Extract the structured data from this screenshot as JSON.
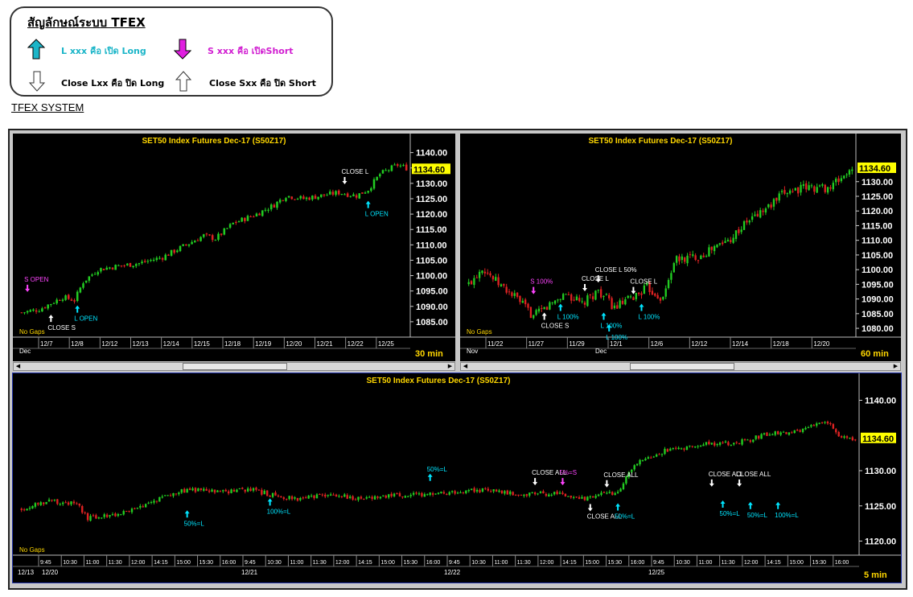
{
  "legend": {
    "title": "สัญลักษณ์ระบบ TFEX",
    "items": [
      {
        "label": "L xxx คือ เปิด Long",
        "color": "#1bb5c8",
        "icon": "arrow-up-filled-cyan"
      },
      {
        "label": "S xxx คือ เปิดShort",
        "color": "#d11fd1",
        "icon": "arrow-down-filled-magenta"
      },
      {
        "label": "Close Lxx คือ ปิด Long",
        "color": "#000000",
        "icon": "arrow-down-outline"
      },
      {
        "label": "Close Sxx คือ ปิด Short",
        "color": "#000000",
        "icon": "arrow-up-outline"
      }
    ]
  },
  "system_title": "TFEX SYSTEM",
  "colors": {
    "up": "#22cc22",
    "down": "#dd2222",
    "title": "#ffd700",
    "last_price_bg": "#ffff00",
    "long": "#00e5ff",
    "short": "#ff44ff",
    "close": "#ffffff"
  },
  "chart_data": [
    {
      "type": "candlestick",
      "title": "SET50 Index Futures Dec-17 (S50Z17)",
      "timeframe": "30 min",
      "note": "No Gaps",
      "last_price": "1134.60",
      "ylim": [
        1080,
        1142
      ],
      "y_ticks": [
        "1140.00",
        "1135.00",
        "1130.00",
        "1125.00",
        "1120.00",
        "1115.00",
        "1110.00",
        "1105.00",
        "1100.00",
        "1095.00",
        "1090.00",
        "1085.00"
      ],
      "x_labels": [
        "12/7",
        "12/8",
        "12/12",
        "12/13",
        "12/14",
        "12/15",
        "12/18",
        "12/19",
        "12/20",
        "12/21",
        "12/22",
        "12/25"
      ],
      "month_label": "Dec",
      "path": [
        [
          0,
          1088
        ],
        [
          6,
          1089
        ],
        [
          10,
          1091
        ],
        [
          14,
          1093
        ],
        [
          18,
          1092
        ],
        [
          21,
          1098
        ],
        [
          26,
          1102
        ],
        [
          32,
          1103
        ],
        [
          40,
          1104
        ],
        [
          48,
          1106
        ],
        [
          56,
          1110
        ],
        [
          62,
          1113
        ],
        [
          66,
          1112
        ],
        [
          72,
          1117
        ],
        [
          80,
          1120
        ],
        [
          86,
          1123
        ],
        [
          90,
          1126
        ],
        [
          96,
          1125
        ],
        [
          102,
          1126
        ],
        [
          108,
          1127
        ],
        [
          114,
          1126
        ],
        [
          118,
          1128
        ],
        [
          122,
          1133
        ],
        [
          128,
          1136
        ],
        [
          131,
          1135
        ]
      ],
      "signals": [
        {
          "i": 2,
          "label": "S OPEN",
          "kind": "short",
          "price": 1096,
          "pos": "above"
        },
        {
          "i": 10,
          "label": "CLOSE S",
          "kind": "close-short",
          "price": 1086,
          "pos": "below"
        },
        {
          "i": 19,
          "label": "L OPEN",
          "kind": "long",
          "price": 1089,
          "pos": "below"
        },
        {
          "i": 110,
          "label": "CLOSE L",
          "kind": "close-long",
          "price": 1131,
          "pos": "above"
        },
        {
          "i": 118,
          "label": "L OPEN",
          "kind": "long",
          "price": 1123,
          "pos": "below"
        }
      ]
    },
    {
      "type": "candlestick",
      "title": "SET50 Index Futures Dec-17 (S50Z17)",
      "timeframe": "60 min",
      "note": "No Gaps",
      "last_price": "1134.60",
      "ylim": [
        1077,
        1142
      ],
      "y_ticks": [
        "1130.00",
        "1125.00",
        "1120.00",
        "1115.00",
        "1110.00",
        "1105.00",
        "1100.00",
        "1095.00",
        "1090.00",
        "1085.00",
        "1080.00"
      ],
      "x_labels": [
        "11/22",
        "11/27",
        "11/29",
        "12/1",
        "12/6",
        "12/12",
        "12/14",
        "12/18",
        "12/20"
      ],
      "month_labels": [
        "Nov",
        "Dec"
      ],
      "path": [
        [
          0,
          1095
        ],
        [
          5,
          1101
        ],
        [
          10,
          1096
        ],
        [
          18,
          1090
        ],
        [
          24,
          1084
        ],
        [
          30,
          1088
        ],
        [
          36,
          1092
        ],
        [
          42,
          1088
        ],
        [
          48,
          1093
        ],
        [
          54,
          1087
        ],
        [
          60,
          1090
        ],
        [
          66,
          1094
        ],
        [
          72,
          1090
        ],
        [
          76,
          1103
        ],
        [
          86,
          1105
        ],
        [
          96,
          1110
        ],
        [
          104,
          1117
        ],
        [
          112,
          1122
        ],
        [
          118,
          1127
        ],
        [
          126,
          1128
        ],
        [
          134,
          1128
        ],
        [
          140,
          1133
        ],
        [
          142,
          1133
        ]
      ],
      "signals": [
        {
          "i": 24,
          "label": "S 100%",
          "kind": "short",
          "price": 1093,
          "pos": "above"
        },
        {
          "i": 28,
          "label": "CLOSE S",
          "kind": "close-short",
          "price": 1084,
          "pos": "below"
        },
        {
          "i": 34,
          "label": "L 100%",
          "kind": "long",
          "price": 1087,
          "pos": "below"
        },
        {
          "i": 43,
          "label": "CLOSE L",
          "kind": "close-long",
          "price": 1094,
          "pos": "above"
        },
        {
          "i": 48,
          "label": "CLOSE L 50%",
          "kind": "close-long",
          "price": 1097,
          "pos": "above"
        },
        {
          "i": 50,
          "label": "L 100%",
          "kind": "long",
          "price": 1084,
          "pos": "below"
        },
        {
          "i": 52,
          "label": "L 100%",
          "kind": "long",
          "price": 1080,
          "pos": "below"
        },
        {
          "i": 61,
          "label": "CLOSE L",
          "kind": "close-long",
          "price": 1093,
          "pos": "above"
        },
        {
          "i": 64,
          "label": "L 100%",
          "kind": "long",
          "price": 1087,
          "pos": "below"
        }
      ]
    },
    {
      "type": "candlestick",
      "title": "SET50 Index Futures Dec-17 (S50Z17)",
      "timeframe": "5 min",
      "note": "No Gaps",
      "last_price": "1134.60",
      "ylim": [
        1118,
        1142
      ],
      "y_ticks": [
        "1140.00",
        "1130.00",
        "1125.00",
        "1120.00"
      ],
      "x_labels": [
        "9:45",
        "10:30",
        "11:00",
        "11:30",
        "12:00",
        "14:15",
        "15:00",
        "15:30",
        "16:00",
        "9:45",
        "10:30",
        "11:00",
        "11:30",
        "12:00",
        "14:15",
        "15:00",
        "15:30",
        "16:00",
        "9:45",
        "10:30",
        "11:00",
        "11:30",
        "12:00",
        "14:15",
        "15:00",
        "15:30",
        "16:00",
        "9:45",
        "10:30",
        "11:00",
        "11:30",
        "12:00",
        "14:15",
        "15:00",
        "15:30",
        "16:00"
      ],
      "day_labels": [
        "12/13",
        "12/20",
        "12/21",
        "12/22",
        "12/25"
      ],
      "path": [
        [
          0,
          1124.5
        ],
        [
          10,
          1125.8
        ],
        [
          20,
          1125.2
        ],
        [
          24,
          1123.2
        ],
        [
          34,
          1123.8
        ],
        [
          44,
          1124.8
        ],
        [
          52,
          1126.6
        ],
        [
          62,
          1127.3
        ],
        [
          72,
          1126.9
        ],
        [
          82,
          1127.4
        ],
        [
          92,
          1126.4
        ],
        [
          102,
          1126.0
        ],
        [
          112,
          1126.6
        ],
        [
          122,
          1126.1
        ],
        [
          134,
          1126.5
        ],
        [
          148,
          1126.6
        ],
        [
          158,
          1127.0
        ],
        [
          170,
          1127.3
        ],
        [
          182,
          1126.5
        ],
        [
          192,
          1126.8
        ],
        [
          202,
          1126.0
        ],
        [
          210,
          1126.6
        ],
        [
          216,
          1127.0
        ],
        [
          222,
          1131.0
        ],
        [
          234,
          1133.0
        ],
        [
          248,
          1133.8
        ],
        [
          260,
          1134.0
        ],
        [
          272,
          1135.3
        ],
        [
          282,
          1135.6
        ],
        [
          292,
          1137.0
        ],
        [
          296,
          1135.0
        ],
        [
          302,
          1134.6
        ]
      ],
      "signals": [
        {
          "i": 60,
          "label": "50%=L",
          "kind": "long",
          "price": 1123.8,
          "pos": "below"
        },
        {
          "i": 90,
          "label": "100%=L",
          "kind": "long",
          "price": 1125.5,
          "pos": "below"
        },
        {
          "i": 148,
          "label": "50%=L",
          "kind": "long",
          "price": 1129.0,
          "pos": "above"
        },
        {
          "i": 186,
          "label": "CLOSE ALL",
          "kind": "close-long",
          "price": 1128.5,
          "pos": "above"
        },
        {
          "i": 196,
          "label": "5%=S",
          "kind": "short",
          "price": 1128.5,
          "pos": "above"
        },
        {
          "i": 206,
          "label": "CLOSE ALL",
          "kind": "close-long",
          "price": 1124.8,
          "pos": "below"
        },
        {
          "i": 212,
          "label": "CLOSE ALL",
          "kind": "close-long",
          "price": 1128.2,
          "pos": "above"
        },
        {
          "i": 216,
          "label": "50%=L",
          "kind": "long",
          "price": 1124.8,
          "pos": "below"
        },
        {
          "i": 250,
          "label": "CLOSE ALL",
          "kind": "close-long",
          "price": 1128.3,
          "pos": "above"
        },
        {
          "i": 260,
          "label": "CLOSE ALL",
          "kind": "close-long",
          "price": 1128.3,
          "pos": "above"
        },
        {
          "i": 254,
          "label": "50%=L",
          "kind": "long",
          "price": 1125.2,
          "pos": "below"
        },
        {
          "i": 264,
          "label": "50%=L",
          "kind": "long",
          "price": 1125.0,
          "pos": "below"
        },
        {
          "i": 274,
          "label": "100%=L",
          "kind": "long",
          "price": 1125.0,
          "pos": "below"
        }
      ]
    }
  ]
}
